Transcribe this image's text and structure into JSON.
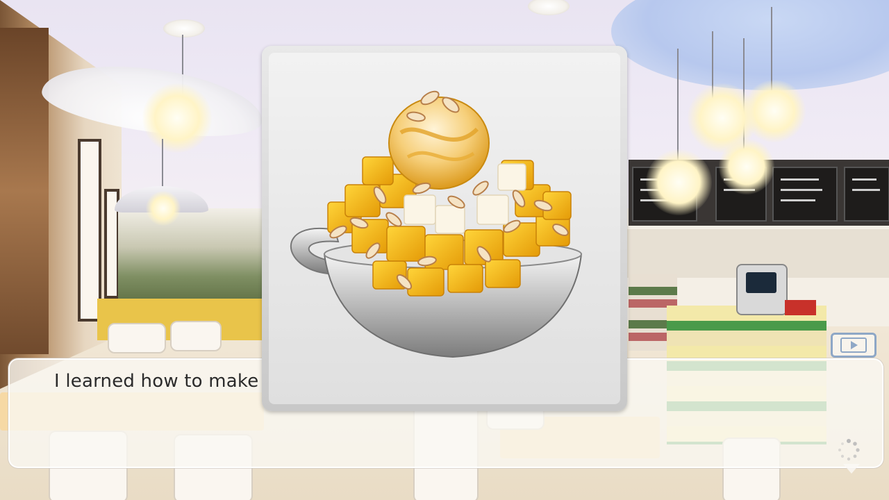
{
  "dialogue": {
    "text": "I learned how to make Mango Shaved Ice."
  },
  "item_reveal": {
    "icon": "mango-shaved-ice-icon"
  },
  "controls": {
    "auto_icon": "play-icon",
    "loading_icon": "loading-spinner-icon"
  },
  "colors": {
    "dialogue_text": "#2b2b2b",
    "auto_button_border": "#8ea7c6",
    "mango": "#f2b51e"
  }
}
